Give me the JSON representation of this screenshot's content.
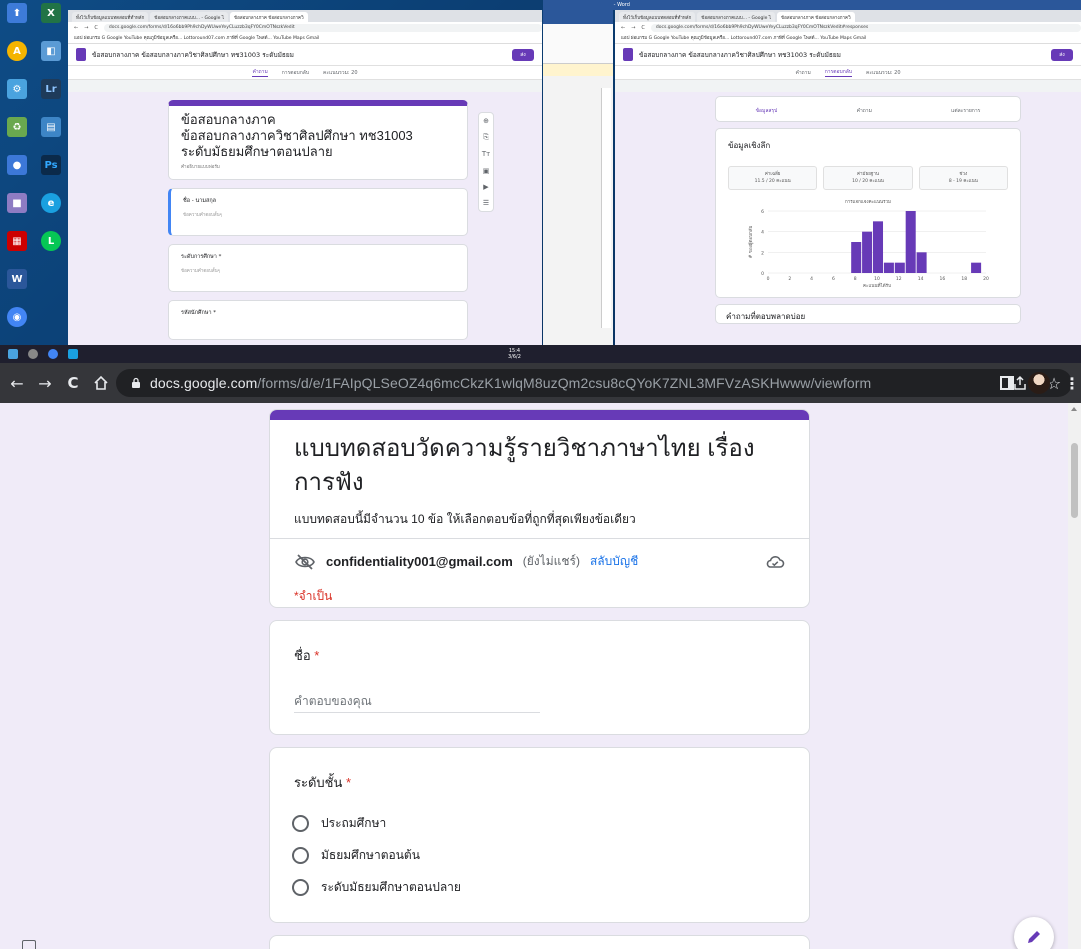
{
  "remote": {
    "word_title": "Document1 - Word",
    "left_window": {
      "tabs": [
        "ทั้งไว้เก็บข้อมูลแบบทดสอบที่ทำหลัก",
        "ข้อสอบกลางภาคแบบ...  - Google ไ",
        "ข้อสอบกลางภาค ข้อสอบกลางภาควิ"
      ],
      "url": "docs.google.com/forms/d/16o6bb9Ph9chDyWUweYeyCLuzzb3qFY0CmOTNszkVedit",
      "bookmarks": "แอป   ผ่อแกรม   G Google   YouTube   คุณภูมิข้อมูลเครือ...   Lottoround07.com   ภาษีที่ Google โพสต์...   YouTube   Maps   Gmail",
      "app_title": "ข้อสอบกลางภาค ข้อสอบกลางภาควิชาศิลปศึกษา ทช31003 ระดับมัธยม",
      "send": "ส่ง",
      "subtab_questions": "คำถาม",
      "subtab_responses": "การตอบกลับ",
      "subtab_score": "คะแนนรวม: 20",
      "form_title_lines": [
        "ข้อสอบกลางภาค",
        "ข้อสอบกลางภาควิชาศิลปศึกษา ทช31003",
        "ระดับมัธยมศึกษาตอนปลาย"
      ],
      "form_desc": "คำอธิบายแบบฟอร์ม",
      "q1": "ชื่อ - นามสกุล",
      "q1_ans": "ข้อความคำตอบสั้นๆ",
      "q2": "ระดับการศึกษา *",
      "q2_ans": "ข้อความคำตอบสั้นๆ",
      "q3": "รหัสนักศึกษา *"
    },
    "right_window": {
      "tabs": [
        "ทั้งไว้เก็บข้อมูลแบบทดสอบที่ทำหลัก",
        "ข้อสอบกลางภาคแบบ...  - Google ไ",
        "ข้อสอบกลางภาค ข้อสอบกลางภาควิ"
      ],
      "url": "docs.google.com/forms/d/16o6bb9Ph9chDyWUweYeyCLuzzb3qFY0CmOTNszkVedit#responses",
      "app_title": "ข้อสอบกลางภาค ข้อสอบกลางภาควิชาศิลปศึกษา ทช31003 ระดับมัธยม",
      "send": "ส่ง",
      "resp_tabs": [
        "ข้อมูลสรุป",
        "คำถาม",
        "แต่ละรายการ"
      ],
      "stats_title": "ข้อมูลเชิงลึก",
      "stats": [
        {
          "label": "ค่าเฉลี่ย",
          "value": "11.5 / 20 คะแนน"
        },
        {
          "label": "ค่ามัธยฐาน",
          "value": "10 / 20 คะแนน"
        },
        {
          "label": "ช่วง",
          "value": "8 - 19 คะแนน"
        }
      ],
      "chart_title": "การแจกแจงคะแนนรวม",
      "bottom_title": "คำถามที่ตอบพลาดบ่อย"
    },
    "taskbar_time": "15:4",
    "taskbar_date": "3/6/2"
  },
  "chart_data": {
    "type": "bar",
    "title": "การแจกแจงคะแนนรวม",
    "xlabel": "คะแนนที่ได้รับ",
    "ylabel": "# ของผู้ตอบกลับ",
    "x": [
      8,
      9,
      10,
      11,
      12,
      13,
      14,
      19
    ],
    "values": [
      3,
      4,
      5,
      1,
      1,
      6,
      2,
      1
    ],
    "xlim": [
      0,
      20
    ],
    "ylim": [
      0,
      6
    ],
    "xticks": [
      "0",
      "2",
      "4",
      "6",
      "8",
      "10",
      "12",
      "14",
      "16",
      "18",
      "20"
    ],
    "yticks": [
      "0",
      "2",
      "4",
      "6"
    ],
    "bar_color": "#673ab7"
  },
  "browser": {
    "url_host": "docs.google.com",
    "url_path": "/forms/d/e/1FAIpQLSeOZ4q6mcCkzK1wlqM8uzQm2csu8cQYoK7ZNL3MFVzASKHwww/viewform"
  },
  "form": {
    "title": "แบบทดสอบวัดความรู้รายวิชาภาษาไทย เรื่องการฟัง",
    "description": "แบบทดสอบนี้มีจำนวน 10 ข้อ ให้เลือกตอบข้อที่ถูกที่สุดเพียงข้อเดียว",
    "account_email": "confidentiality001@gmail.com",
    "account_note": "(ยังไม่แชร์)",
    "switch_account": "สลับบัญชี",
    "required_note": "*จำเป็น",
    "q_name": {
      "label": "ชื่อ",
      "star": "*",
      "placeholder": "คำตอบของคุณ"
    },
    "q_grade": {
      "label": "ระดับชั้น",
      "star": "*",
      "options": [
        "ประถมศึกษา",
        "มัธยมศึกษาตอนต้น",
        "ระดับมัธยมศึกษาตอนปลาย"
      ]
    }
  },
  "colors": {
    "accent": "#673ab7",
    "required": "#d93025",
    "link": "#1a73e8"
  }
}
